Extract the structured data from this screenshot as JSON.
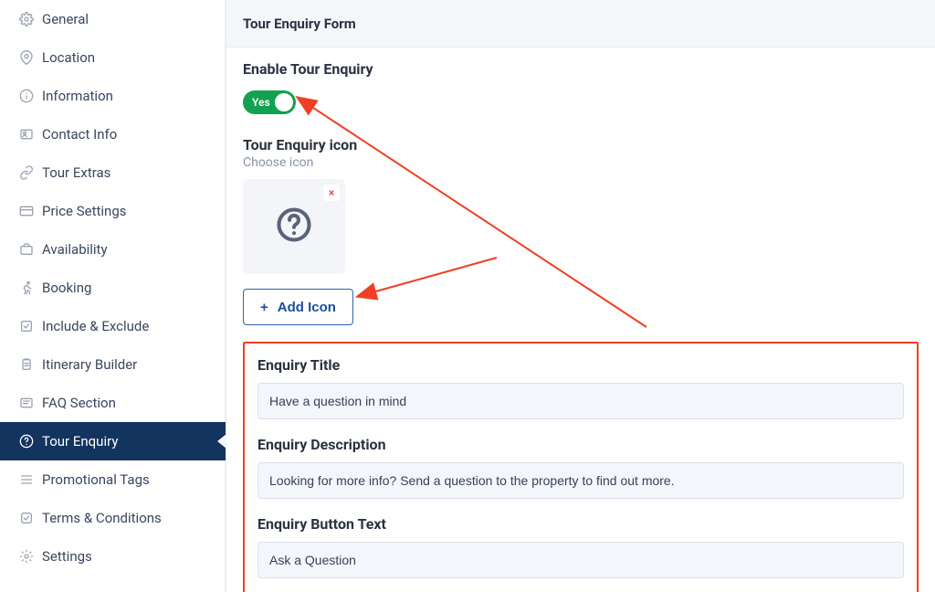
{
  "header": {
    "title": "Tour Enquiry Form"
  },
  "sidebar": {
    "items": [
      {
        "label": "General",
        "active": false
      },
      {
        "label": "Location",
        "active": false
      },
      {
        "label": "Information",
        "active": false
      },
      {
        "label": "Contact Info",
        "active": false
      },
      {
        "label": "Tour Extras",
        "active": false
      },
      {
        "label": "Price Settings",
        "active": false
      },
      {
        "label": "Availability",
        "active": false
      },
      {
        "label": "Booking",
        "active": false
      },
      {
        "label": "Include & Exclude",
        "active": false
      },
      {
        "label": "Itinerary Builder",
        "active": false
      },
      {
        "label": "FAQ Section",
        "active": false
      },
      {
        "label": "Tour Enquiry",
        "active": true
      },
      {
        "label": "Promotional Tags",
        "active": false
      },
      {
        "label": "Terms & Conditions",
        "active": false
      },
      {
        "label": "Settings",
        "active": false
      }
    ]
  },
  "enable_enquiry": {
    "label": "Enable Tour Enquiry",
    "toggle_state_label": "Yes"
  },
  "icon_picker": {
    "title": "Tour Enquiry icon",
    "subtitle": "Choose icon",
    "remove_label": "×",
    "add_button_label": "Add Icon"
  },
  "fields": {
    "title": {
      "label": "Enquiry Title",
      "value": "Have a question in mind"
    },
    "description": {
      "label": "Enquiry Description",
      "value": "Looking for more info? Send a question to the property to find out more."
    },
    "button_text": {
      "label": "Enquiry Button Text",
      "value": "Ask a Question"
    }
  },
  "colors": {
    "accent_dark": "#12345f",
    "annotation": "#ef4023",
    "toggle_green": "#12a150"
  }
}
